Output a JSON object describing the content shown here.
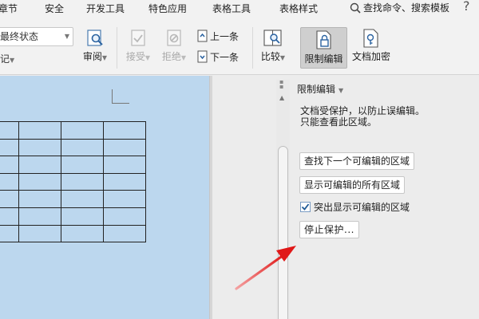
{
  "menu": {
    "items": [
      "章节",
      "安全",
      "开发工具",
      "特色应用",
      "表格工具",
      "表格样式"
    ],
    "search_label": "查找命令、搜索模板",
    "help": "?"
  },
  "ribbon": {
    "status_value": "最终状态",
    "cut_label": "记",
    "review_label": "审阅",
    "accept_label": "接受",
    "reject_label": "拒绝",
    "prev_label": "上一条",
    "next_label": "下一条",
    "compare_label": "比较",
    "restrict_label": "限制编辑",
    "encrypt_label": "文档加密"
  },
  "panel": {
    "title": "限制编辑",
    "desc_line1": "文档受保护，以防止误编辑。",
    "desc_line2": "只能查看此区域。",
    "find_next_button": "查找下一个可编辑的区域",
    "show_all_button": "显示可编辑的所有区域",
    "highlight_label": "突出显示可编辑的区域",
    "highlight_checked": true,
    "stop_button": "停止保护..."
  },
  "colors": {
    "document_bg": "#bcd7ee",
    "arrow": "#e01818",
    "active_tool": "#cfcfcf"
  }
}
